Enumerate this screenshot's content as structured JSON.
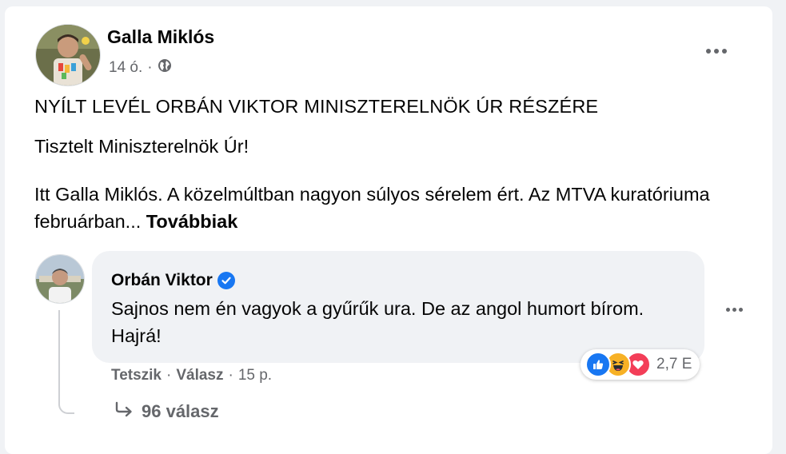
{
  "post": {
    "author": "Galla Miklós",
    "time": "14 ó.",
    "separator": "·",
    "audience_icon": "globe-icon",
    "more_icon": "more-horizontal-icon",
    "paragraphs": [
      "NYÍLT LEVÉL ORBÁN VIKTOR MINISZTERELNÖK ÚR RÉSZÉRE",
      "Tisztelt Miniszterelnök Úr!",
      "Itt Galla Miklós. A közelmúltban nagyon súlyos sérelem ért. Az MTVA kuratóriuma februárban..."
    ],
    "see_more": "Továbbiak"
  },
  "comment": {
    "author": "Orbán Viktor",
    "verified_icon": "verified-badge-icon",
    "text": "Sajnos nem én vagyok a gyűrűk ura. De az angol humort bírom. Hajrá!",
    "like_label": "Tetszik",
    "reply_label": "Válasz",
    "separator": "·",
    "time": "15 p.",
    "reactions": {
      "icons": [
        "like-reaction-icon",
        "haha-reaction-icon",
        "love-reaction-icon"
      ],
      "count": "2,7 E"
    },
    "replies_label": "96 válasz",
    "replies_icon": "reply-arrow-icon"
  },
  "colors": {
    "background": "#f0f2f5",
    "card": "#ffffff",
    "text_primary": "#050505",
    "text_secondary": "#65676b",
    "facebook_blue": "#1877f2",
    "haha_yellow": "#f7b125",
    "love_red": "#f33e58"
  }
}
